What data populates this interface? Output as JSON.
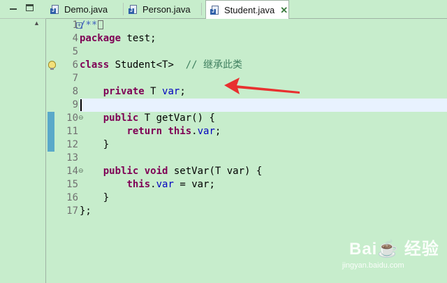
{
  "tabs": [
    {
      "label": "Demo.java",
      "active": false
    },
    {
      "label": "Person.java",
      "active": false
    },
    {
      "label": "Student.java",
      "active": true,
      "close": "✕"
    }
  ],
  "editor": {
    "lines": [
      {
        "num": "1",
        "fold": "plus"
      },
      {
        "num": "4"
      },
      {
        "num": "5"
      },
      {
        "num": "6"
      },
      {
        "num": "7"
      },
      {
        "num": "8"
      },
      {
        "num": "9"
      },
      {
        "num": "10",
        "fold": "minus"
      },
      {
        "num": "11"
      },
      {
        "num": "12"
      },
      {
        "num": "13"
      },
      {
        "num": "14",
        "fold": "minus"
      },
      {
        "num": "15"
      },
      {
        "num": "16"
      },
      {
        "num": "17"
      }
    ],
    "code": {
      "l1_comment": "/**",
      "l4_kw": "package",
      "l4_rest": " test;",
      "l6_kw": "class",
      "l6_rest": " Student<T>",
      "l6_comment": "  // 继承此类",
      "l8_kw": "private",
      "l8_type": " T ",
      "l8_field": "var",
      "l8_end": ";",
      "l10_kw": "public",
      "l10_rest": " T getVar() {",
      "l11_kw": "return",
      "l11_this": "this",
      "l11_dot": ".",
      "l11_field": "var",
      "l11_end": ";",
      "l12": "}",
      "l14_kw1": "public",
      "l14_kw2": "void",
      "l14_rest": " setVar(T ",
      "l14_param": "var",
      "l14_end": ") {",
      "l15_this": "this",
      "l15_dot": ".",
      "l15_field": "var",
      "l15_mid": " = ",
      "l15_param": "var",
      "l15_end": ";",
      "l16": "}",
      "l17": "};"
    }
  },
  "watermark": {
    "logo": "Bai☕ 经验",
    "site": "jingyan.baidu.com"
  },
  "colors": {
    "background": "#c7edcc",
    "keyword": "#7f0055",
    "comment": "#3f5fbf",
    "field": "#0000c0",
    "arrow": "#e8302f",
    "current_line": "#e8f2fe"
  }
}
